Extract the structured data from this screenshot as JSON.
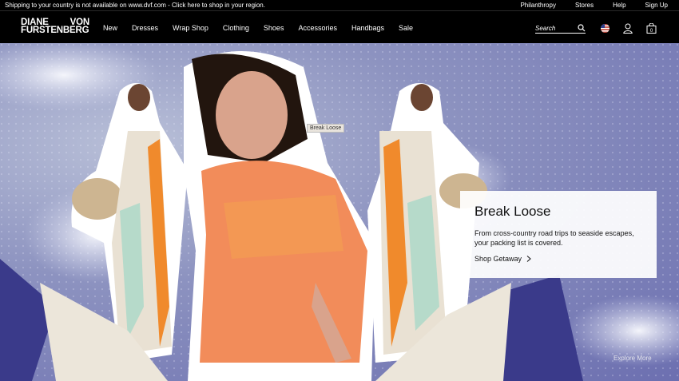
{
  "topbar": {
    "shipping_message": "Shipping to your country is not available on www.dvf.com - Click here to shop in your region.",
    "links": [
      "Philanthropy",
      "Stores",
      "Help",
      "Sign Up"
    ]
  },
  "brand": {
    "line1_left": "DIANE",
    "line1_right": "VON",
    "line2": "FURSTENBERG"
  },
  "nav": {
    "items": [
      "New",
      "Dresses",
      "Wrap Shop",
      "Clothing",
      "Shoes",
      "Accessories",
      "Handbags",
      "Sale"
    ]
  },
  "search": {
    "placeholder": "Search"
  },
  "icons": {
    "flag": "us-flag-icon",
    "account": "user-icon",
    "bag": "shopping-bag-icon",
    "bag_count": "0"
  },
  "hero": {
    "tooltip": "Break Loose",
    "card_title": "Break Loose",
    "card_desc": "From cross-country road trips to seaside escapes, your packing list is covered.",
    "cta_label": "Shop Getaway",
    "explore": "Explore More"
  },
  "colors": {
    "accent_orange": "#f28c5a",
    "sky": "#8d93c0",
    "card_bg": "#ffffff"
  }
}
